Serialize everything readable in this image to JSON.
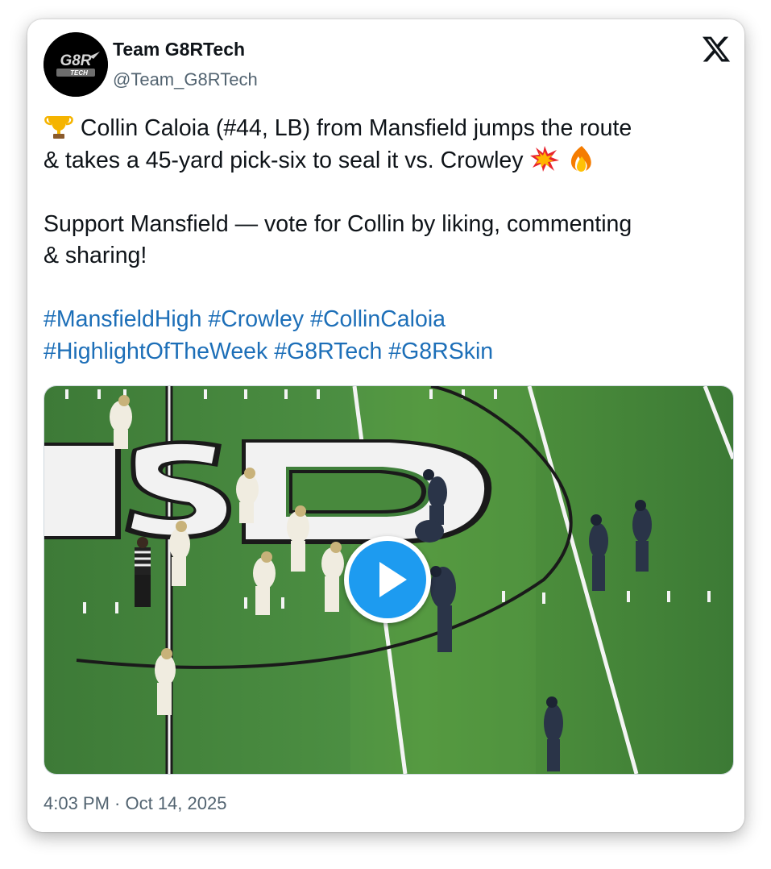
{
  "post": {
    "author": {
      "display_name": "Team G8RTech",
      "handle": "@Team_G8RTech",
      "avatar_text": "G8R TECH"
    },
    "platform_icon": "x-logo-icon",
    "text": {
      "line1": "Collin Caloia (#44, LB) from Mansfield jumps the route",
      "line2": "& takes a 45-yard pick-six to seal it vs. Crowley",
      "line3": "Support Mansfield — vote for Collin by liking, commenting",
      "line4": "& sharing!",
      "emojis": [
        "trophy-icon",
        "collision-icon",
        "fire-icon"
      ]
    },
    "hashtags": {
      "line1": [
        "#MansfieldHigh",
        "#Crowley",
        "#CollinCaloia"
      ],
      "line2": [
        "#HighlightOfTheWeek",
        "#G8RTech",
        "#G8RSkin"
      ]
    },
    "media": {
      "type": "video",
      "field_text": "ISD",
      "play_icon": "play-icon"
    },
    "timestamp": "4:03 PM · Oct 14, 2025"
  },
  "colors": {
    "link": "#1d6fb8",
    "play": "#1d9bf0",
    "field_green": "#3f7f3a",
    "text_secondary": "#536471"
  }
}
